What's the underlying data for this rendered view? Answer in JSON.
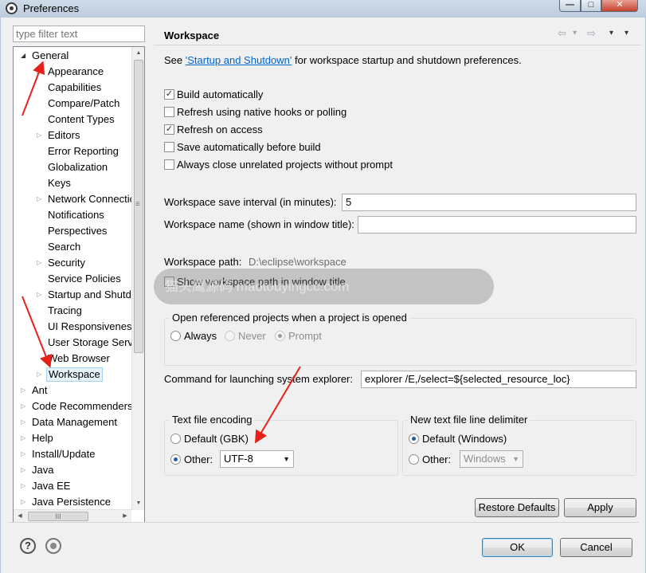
{
  "window": {
    "title": "Preferences",
    "minimize_glyph": "—",
    "maximize_glyph": "□",
    "close_glyph": "✕"
  },
  "filter": {
    "placeholder": "type filter text"
  },
  "tree": {
    "items": [
      {
        "label": "General",
        "arrow": "◢"
      },
      {
        "label": "Appearance",
        "arrow": "▷"
      },
      {
        "label": "Capabilities",
        "arrow": ""
      },
      {
        "label": "Compare/Patch",
        "arrow": ""
      },
      {
        "label": "Content Types",
        "arrow": ""
      },
      {
        "label": "Editors",
        "arrow": "▷"
      },
      {
        "label": "Error Reporting",
        "arrow": ""
      },
      {
        "label": "Globalization",
        "arrow": ""
      },
      {
        "label": "Keys",
        "arrow": ""
      },
      {
        "label": "Network Connectio",
        "arrow": "▷"
      },
      {
        "label": "Notifications",
        "arrow": ""
      },
      {
        "label": "Perspectives",
        "arrow": ""
      },
      {
        "label": "Search",
        "arrow": ""
      },
      {
        "label": "Security",
        "arrow": "▷"
      },
      {
        "label": "Service Policies",
        "arrow": ""
      },
      {
        "label": "Startup and Shutd",
        "arrow": "▷"
      },
      {
        "label": "Tracing",
        "arrow": ""
      },
      {
        "label": "UI Responsiveness",
        "arrow": ""
      },
      {
        "label": "User Storage Serv",
        "arrow": ""
      },
      {
        "label": "Web Browser",
        "arrow": ""
      },
      {
        "label": "Workspace",
        "arrow": "▷"
      },
      {
        "label": "Ant",
        "arrow": "▷"
      },
      {
        "label": "Code Recommenders",
        "arrow": "▷"
      },
      {
        "label": "Data Management",
        "arrow": "▷"
      },
      {
        "label": "Help",
        "arrow": "▷"
      },
      {
        "label": "Install/Update",
        "arrow": "▷"
      },
      {
        "label": "Java",
        "arrow": "▷"
      },
      {
        "label": "Java EE",
        "arrow": "▷"
      },
      {
        "label": "Java Persistence",
        "arrow": "▷"
      }
    ],
    "selected": "Workspace"
  },
  "page": {
    "title": "Workspace",
    "nav": {
      "back": "⇦",
      "back_menu": "▾",
      "forward": "⇨",
      "forward_menu": "▾",
      "view_menu": "▾"
    },
    "see_prefix": "See ",
    "see_link": "'Startup and Shutdown'",
    "see_suffix": " for workspace startup and shutdown preferences.",
    "checkboxes": [
      {
        "label": "Build automatically",
        "checked": true,
        "mark": "✓"
      },
      {
        "label": "Refresh using native hooks or polling",
        "checked": false,
        "mark": ""
      },
      {
        "label": "Refresh on access",
        "checked": true,
        "mark": "✓"
      },
      {
        "label": "Save automatically before build",
        "checked": false,
        "mark": ""
      },
      {
        "label": "Always close unrelated projects without prompt",
        "checked": false,
        "mark": ""
      }
    ],
    "save_interval_label": "Workspace save interval (in minutes):",
    "save_interval_value": "5",
    "workspace_name_label": "Workspace name (shown in window title):",
    "workspace_name_value": "",
    "workspace_path_label": "Workspace path:",
    "workspace_path_value": "D:\\eclipse\\workspace",
    "show_path_label": "Show workspace path in window title",
    "open_projects": {
      "title": "Open referenced projects when a project is opened",
      "options": [
        "Always",
        "Never",
        "Prompt"
      ],
      "selected": "Prompt"
    },
    "explorer_label": "Command for launching system explorer:",
    "explorer_value": "explorer /E,/select=${selected_resource_loc}",
    "encoding": {
      "title": "Text file encoding",
      "default_label": "Default (GBK)",
      "other_label": "Other:",
      "other_value": "UTF-8",
      "selected": "Other"
    },
    "line_delimiter": {
      "title": "New text file line delimiter",
      "default_label": "Default (Windows)",
      "other_label": "Other:",
      "other_value": "Windows",
      "selected": "Default"
    },
    "restore_defaults": "Restore Defaults",
    "apply": "Apply"
  },
  "footer": {
    "help_icon_glyph": "?",
    "ok": "OK",
    "cancel": "Cancel"
  },
  "watermark": {
    "text": "猫头鹰源码 maotouyingcc.com"
  },
  "colors": {
    "link": "#0066cc",
    "annotation_arrow": "#e8201a",
    "selection": "#e5f3fb"
  }
}
